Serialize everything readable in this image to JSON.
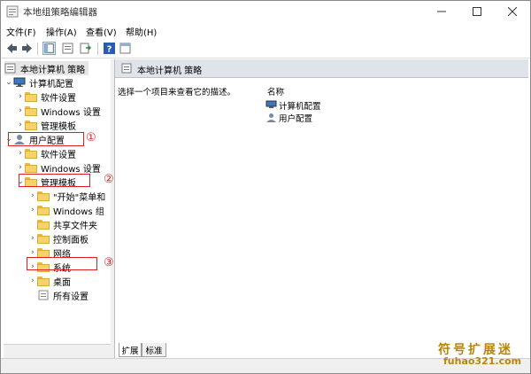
{
  "window": {
    "title": "本地组策略编辑器",
    "controls": [
      "minimize",
      "maximize",
      "close"
    ]
  },
  "menu": [
    "文件(F)",
    "操作(A)",
    "查看(V)",
    "帮助(H)"
  ],
  "tree": {
    "root": "本地计算机 策略",
    "computer_config": "计算机配置",
    "computer_children": [
      "软件设置",
      "Windows 设置",
      "管理模板"
    ],
    "user_config": "用户配置",
    "user_children": [
      "软件设置",
      "Windows 设置"
    ],
    "admin_templates": "管理模板",
    "admin_children": [
      "\"开始\"菜单和",
      "Windows 组",
      "共享文件夹",
      "控制面板",
      "网络",
      "系统",
      "桌面",
      "所有设置"
    ]
  },
  "right": {
    "header": "本地计算机 策略",
    "description": "选择一个项目来查看它的描述。",
    "column_name": "名称",
    "items": [
      "计算机配置",
      "用户配置"
    ]
  },
  "tabs": [
    "扩展",
    "标准"
  ],
  "annotations": [
    "①",
    "②",
    "③"
  ],
  "watermark": {
    "line1": "符号扩展迷",
    "line2": "fuhao321.com"
  },
  "colors": {
    "annotation": "#e02020",
    "header_bg": "#dfe4ea",
    "folder": "#f6d26b",
    "watermark": "#b8860b"
  }
}
